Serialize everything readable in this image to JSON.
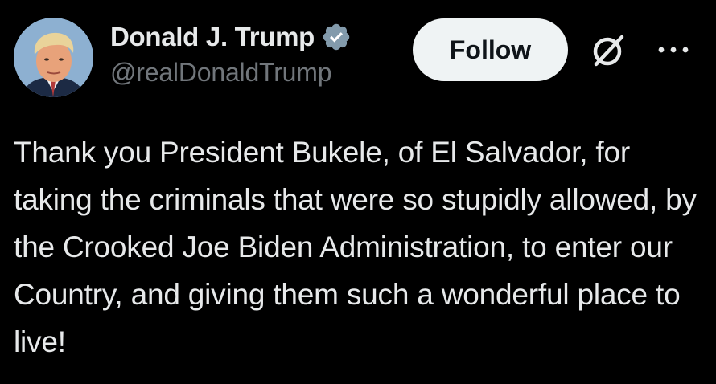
{
  "author": {
    "display_name": "Donald J. Trump",
    "handle": "@realDonaldTrump",
    "verified": true,
    "verified_icon": "verified-badge-icon",
    "verified_color": "#829aab"
  },
  "actions": {
    "follow_label": "Follow",
    "grok_icon": "grok-icon",
    "more_icon": "more-options-icon"
  },
  "tweet": {
    "text": "Thank you President Bukele, of El Salvador, for taking the criminals that were so stupidly allowed, by the Crooked Joe Biden Administration, to enter our Country, and giving them such a wonderful place to live!"
  },
  "colors": {
    "background": "#000000",
    "text_primary": "#e7e9ea",
    "text_secondary": "#71767b",
    "button_bg": "#eff3f4",
    "button_text": "#0f1419"
  }
}
